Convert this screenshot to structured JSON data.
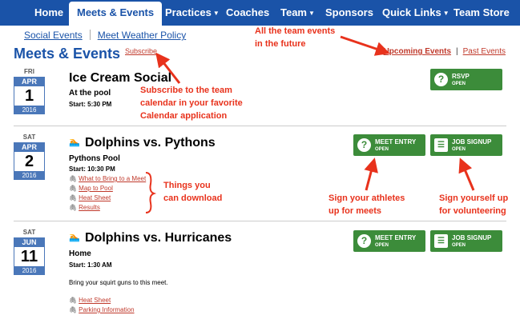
{
  "nav": {
    "items": [
      {
        "label": "Home",
        "caret": false
      },
      {
        "label": "Meets & Events",
        "caret": false
      },
      {
        "label": "Practices",
        "caret": true
      },
      {
        "label": "Coaches",
        "caret": false
      },
      {
        "label": "Team",
        "caret": true
      },
      {
        "label": "Sponsors",
        "caret": false
      },
      {
        "label": "Quick Links",
        "caret": true
      },
      {
        "label": "Team Store",
        "caret": false
      }
    ]
  },
  "subnav": {
    "social": "Social Events",
    "weather": "Meet Weather Policy"
  },
  "page": {
    "title": "Meets & Events",
    "subscribe": "Subscribe"
  },
  "filters": {
    "upcoming": "Upcoming Events",
    "sep": "|",
    "past": "Past Events"
  },
  "events": [
    {
      "dow": "FRI",
      "month": "APR",
      "day": "1",
      "year": "2016",
      "title": "Ice Cream Social",
      "location": "At the pool",
      "start": "Start: 5:30 PM",
      "buttons": [
        {
          "label": "RSVP",
          "status": "OPEN",
          "icon": "?"
        }
      ]
    },
    {
      "dow": "SAT",
      "month": "APR",
      "day": "2",
      "year": "2016",
      "title": "Dolphins vs. Pythons",
      "location": "Pythons Pool",
      "start": "Start: 10:30 PM",
      "links": [
        "What to Bring to a Meet",
        "Map to Pool",
        "Heat Sheet",
        "Results"
      ],
      "buttons": [
        {
          "label": "MEET ENTRY",
          "status": "OPEN",
          "icon": "?"
        },
        {
          "label": "JOB SIGNUP",
          "status": "OPEN",
          "icon": "☰"
        }
      ]
    },
    {
      "dow": "SAT",
      "month": "JUN",
      "day": "11",
      "year": "2016",
      "title": "Dolphins vs. Hurricanes",
      "location": "Home",
      "start": "Start: 1:30 AM",
      "description": "Bring your squirt guns to this meet.",
      "links": [
        "Heat Sheet",
        "Parking Information"
      ],
      "buttons": [
        {
          "label": "MEET ENTRY",
          "status": "OPEN",
          "icon": "?"
        },
        {
          "label": "JOB SIGNUP",
          "status": "OPEN",
          "icon": "☰"
        }
      ]
    }
  ],
  "annotations": {
    "team_events": [
      "All the team events",
      "in the future"
    ],
    "subscribe_note": [
      "Subscribe to the team",
      "calendar in your favorite",
      "Calendar application"
    ],
    "download_note": [
      "Things you",
      "can download"
    ],
    "sign_athletes": [
      "Sign your athletes",
      "up for meets"
    ],
    "sign_yourself": [
      "Sign yourself up",
      "for volunteering"
    ]
  },
  "colors": {
    "nav": "#1a53a8",
    "button": "#3c8c3a",
    "annotation": "#e8321c",
    "date": "#4a77b9"
  }
}
